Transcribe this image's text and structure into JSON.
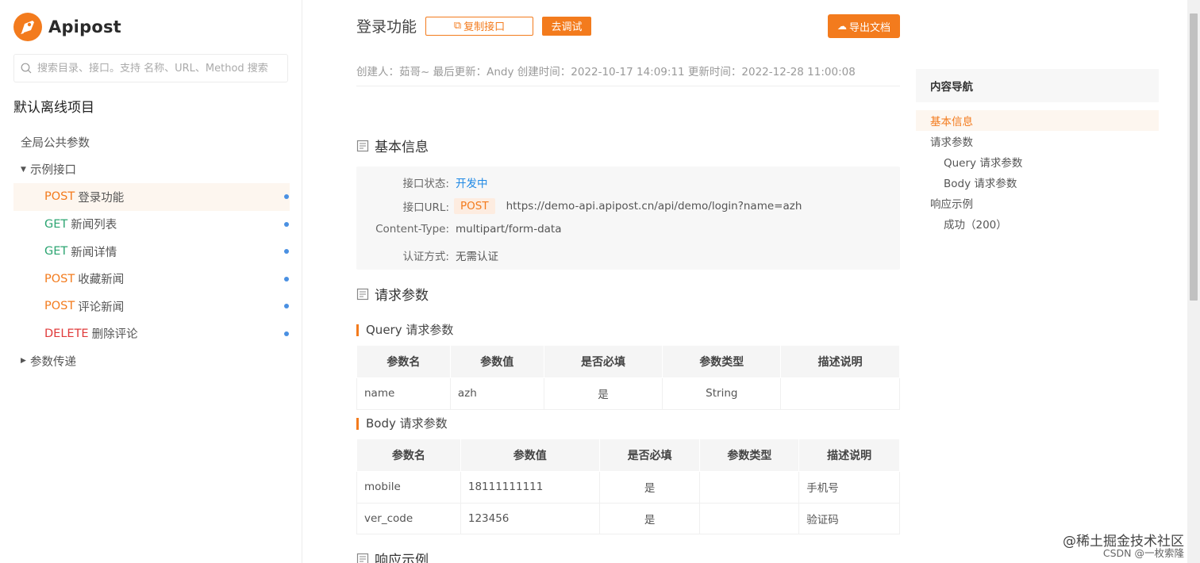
{
  "brand": {
    "name": "Apipost"
  },
  "search": {
    "placeholder": "搜索目录、接口。支持 名称、URL、Method 搜索"
  },
  "project": {
    "title": "默认离线项目"
  },
  "tree": {
    "global_params": "全局公共参数",
    "folder_examples": "示例接口",
    "folder_params": "参数传递",
    "items": [
      {
        "method": "POST",
        "name": "登录功能"
      },
      {
        "method": "GET",
        "name": "新闻列表"
      },
      {
        "method": "GET",
        "name": "新闻详情"
      },
      {
        "method": "POST",
        "name": "收藏新闻"
      },
      {
        "method": "POST",
        "name": "评论新闻"
      },
      {
        "method": "DELETE",
        "name": "删除评论"
      }
    ]
  },
  "header": {
    "title": "登录功能",
    "copy_label": "复制接口",
    "debug_label": "去调试",
    "export_label": "导出文档"
  },
  "meta": {
    "text": "创建人：茹哥~ 最后更新：Andy 创建时间：2022-10-17 14:09:11   更新时间：2022-12-28 11:00:08"
  },
  "basic": {
    "heading": "基本信息",
    "status_label": "接口状态:",
    "status_value": "开发中",
    "url_label": "接口URL:",
    "url_method": "POST",
    "url_value": "https://demo-api.apipost.cn/api/demo/login?name=azh",
    "ctype_label": "Content-Type:",
    "ctype_value": "multipart/form-data",
    "auth_label": "认证方式:",
    "auth_value": "无需认证"
  },
  "request": {
    "heading": "请求参数",
    "query_heading": "Query 请求参数",
    "body_heading": "Body 请求参数",
    "columns": [
      "参数名",
      "参数值",
      "是否必填",
      "参数类型",
      "描述说明"
    ],
    "query_rows": [
      {
        "name": "name",
        "value": "azh",
        "required": "是",
        "type": "String",
        "desc": ""
      }
    ],
    "body_rows": [
      {
        "name": "mobile",
        "value": "18111111111",
        "required": "是",
        "type": "",
        "desc": "手机号"
      },
      {
        "name": "ver_code",
        "value": "123456",
        "required": "是",
        "type": "",
        "desc": "验证码"
      }
    ]
  },
  "response": {
    "heading": "响应示例"
  },
  "toc": {
    "title": "内容导航",
    "items": [
      {
        "label": "基本信息",
        "level": 0,
        "active": true
      },
      {
        "label": "请求参数",
        "level": 0,
        "active": false
      },
      {
        "label": "Query 请求参数",
        "level": 1,
        "active": false
      },
      {
        "label": "Body 请求参数",
        "level": 1,
        "active": false
      },
      {
        "label": "响应示例",
        "level": 0,
        "active": false
      },
      {
        "label": "成功（200）",
        "level": 1,
        "active": false
      }
    ]
  },
  "watermark": {
    "line1": "@稀土掘金技术社区",
    "line2": "CSDN @一枚索隆"
  },
  "colors": {
    "accent": "#f37b1d",
    "get": "#2ba471",
    "delete": "#e03b3b",
    "status": "#1e88e5",
    "dot": "#4a90e2"
  }
}
